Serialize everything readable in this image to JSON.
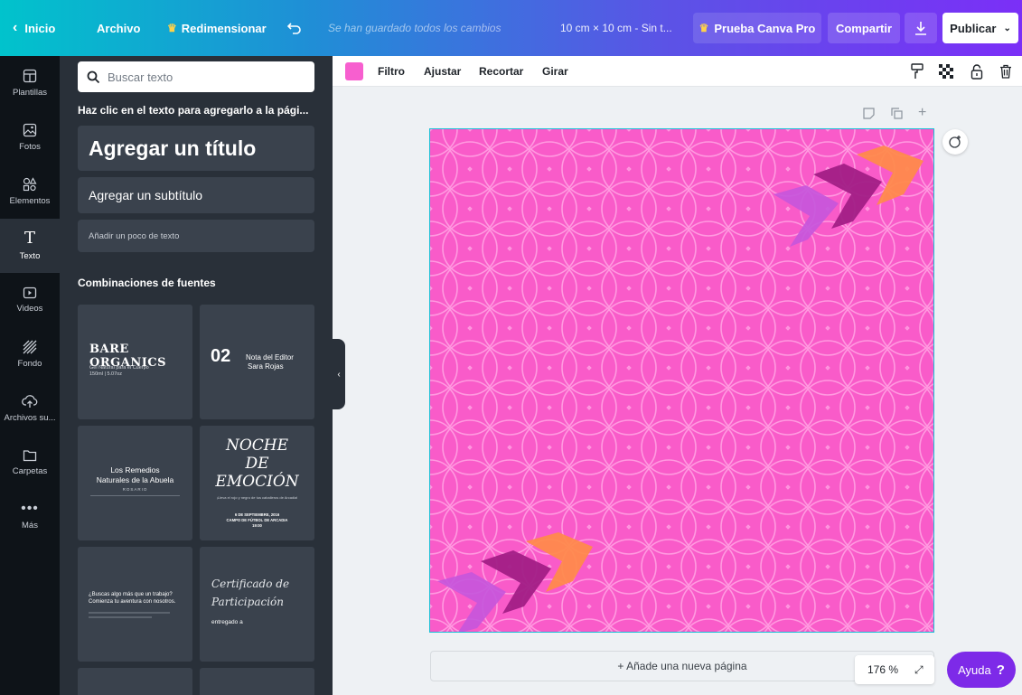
{
  "topbar": {
    "home": "Inicio",
    "file": "Archivo",
    "resize": "Redimensionar",
    "saved_status": "Se han guardado todos los cambios",
    "doc_title": "10 cm × 10 cm - Sin t...",
    "pro_trial": "Prueba Canva Pro",
    "share": "Compartir",
    "publish": "Publicar"
  },
  "rail": {
    "items": [
      {
        "label": "Plantillas",
        "icon": "layout-icon"
      },
      {
        "label": "Fotos",
        "icon": "photo-icon"
      },
      {
        "label": "Elementos",
        "icon": "shapes-icon"
      },
      {
        "label": "Texto",
        "icon": "text-icon"
      },
      {
        "label": "Videos",
        "icon": "video-icon"
      },
      {
        "label": "Fondo",
        "icon": "background-icon"
      },
      {
        "label": "Archivos su...",
        "icon": "upload-icon"
      },
      {
        "label": "Carpetas",
        "icon": "folder-icon"
      },
      {
        "label": "Más",
        "icon": "more-icon"
      }
    ],
    "active_index": 3
  },
  "panel": {
    "search_placeholder": "Buscar texto",
    "hint": "Haz clic en el texto para agregarlo a la pági...",
    "add_title": "Agregar un título",
    "add_subtitle": "Agregar un subtítulo",
    "add_body": "Añadir un poco de texto",
    "combos_heading": "Combinaciones de fuentes",
    "combo1": {
      "title": "BARE ORGANICS",
      "line1": "Gel Natural para el Cuerpo",
      "line2": "150ml | 5.07oz"
    },
    "combo2": {
      "number": "02",
      "line1": "Nota del Editor",
      "line2": "Sara Rojas"
    },
    "combo3": {
      "line1": "Los Remedios",
      "line2": "Naturales de la Abuela",
      "line3": "ROSARIO"
    },
    "combo4": {
      "line1": "NOCHE",
      "line2": "DE",
      "line3": "EMOCIÓN",
      "small": "¡Lleva el rojo y negro de tus caballeros de Arcadia!",
      "date": "6 DE SEPTIEMBRE, 2016",
      "place": "CAMPO DE FÚTBOL DE ARCADIA",
      "time": "19:00"
    },
    "combo5": {
      "line1": "¿Buscas algo más que un trabajo?",
      "line2": "Comienza tu aventura con nosotros."
    },
    "combo6": {
      "line1": "Certificado de",
      "line2": "Participación",
      "line3": "entregado a"
    }
  },
  "toolbar": {
    "filter": "Filtro",
    "adjust": "Ajustar",
    "crop": "Recortar",
    "rotate": "Girar",
    "swatch_color": "#f75fcf"
  },
  "canvas": {
    "background_color": "#f95bc9",
    "add_page": "+ Añade una nueva página",
    "zoom": "176 %"
  },
  "help": {
    "label": "Ayuda",
    "mark": "?"
  },
  "colors": {
    "accent_purple": "#7d2ae8",
    "selection": "#19c0d6"
  }
}
